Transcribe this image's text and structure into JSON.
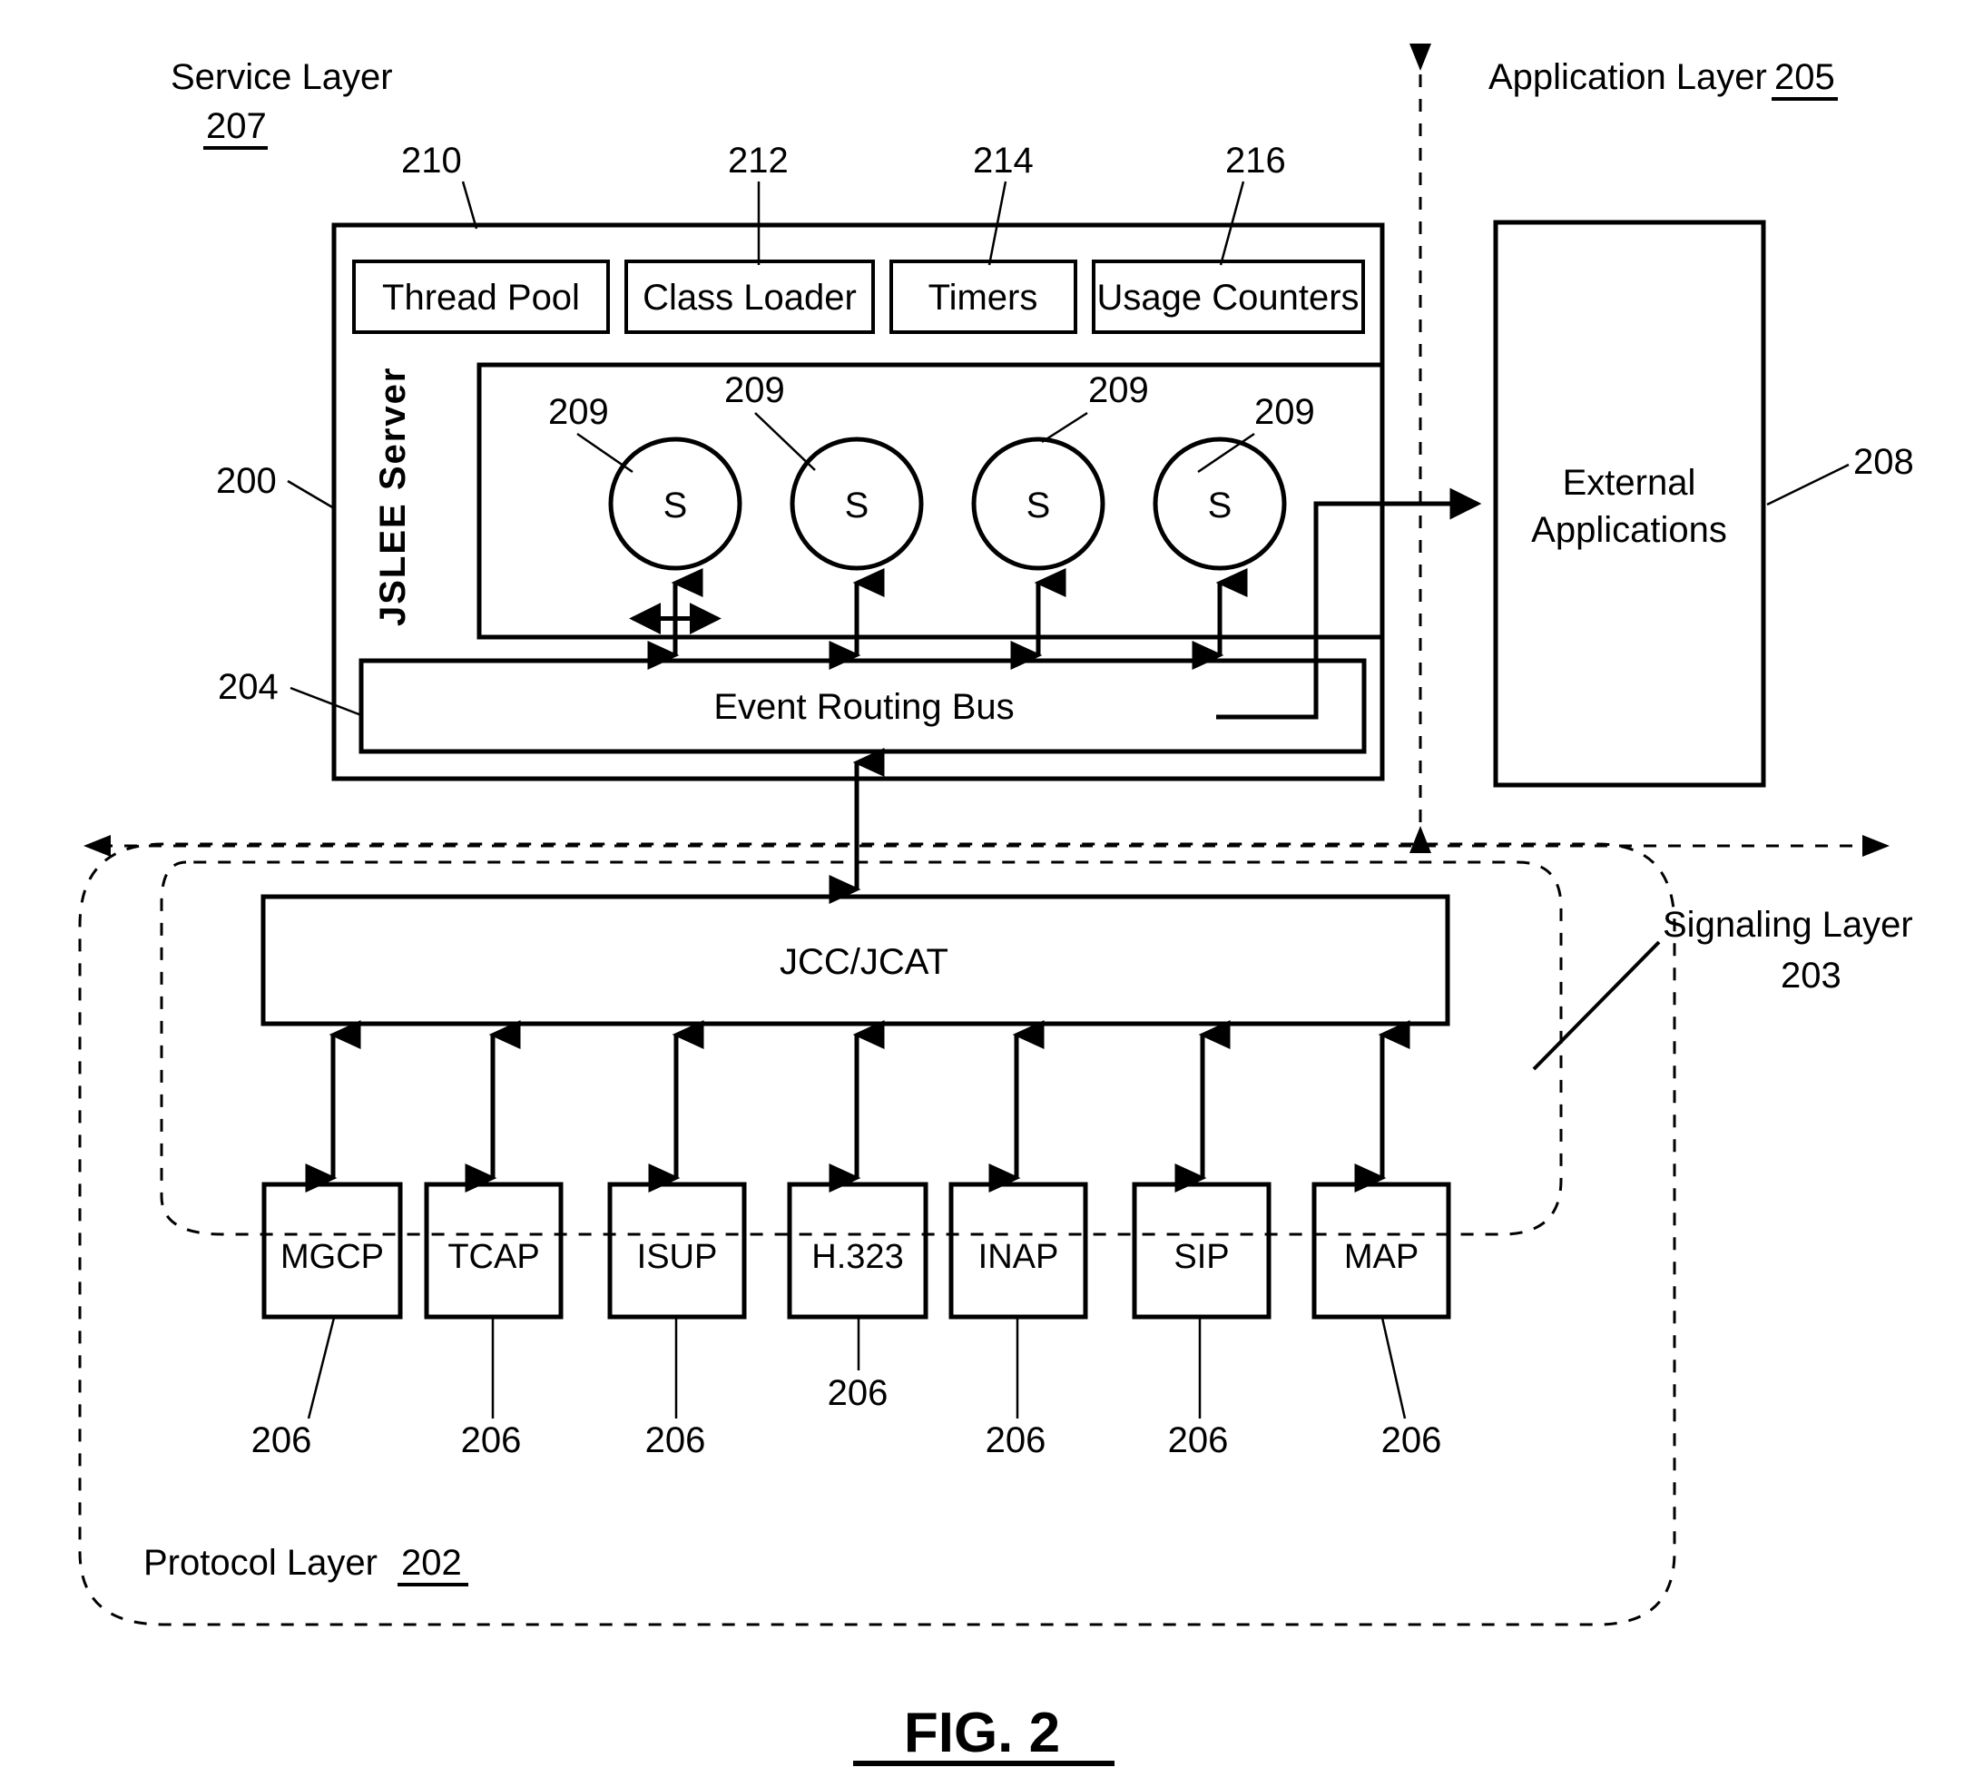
{
  "figure": {
    "caption": "FIG. 2"
  },
  "layers": {
    "service": {
      "name": "Service Layer",
      "ref": "207"
    },
    "application": {
      "name": "Application Layer",
      "ref": "205"
    },
    "signaling": {
      "name": "Signaling Layer",
      "ref": "203"
    },
    "protocol": {
      "name": "Protocol Layer",
      "ref": "202"
    }
  },
  "server": {
    "label": "JSLEE Server",
    "ref": "200",
    "components": [
      {
        "label": "Thread Pool",
        "ref": "210"
      },
      {
        "label": "Class Loader",
        "ref": "212"
      },
      {
        "label": "Timers",
        "ref": "214"
      },
      {
        "label": "Usage Counters",
        "ref": "216"
      }
    ],
    "services": [
      {
        "label": "S",
        "ref": "209"
      },
      {
        "label": "S",
        "ref": "209"
      },
      {
        "label": "S",
        "ref": "209"
      },
      {
        "label": "S",
        "ref": "209"
      }
    ],
    "event_bus": {
      "label": "Event Routing Bus",
      "ref": "204"
    }
  },
  "external_applications": {
    "label_line1": "External",
    "label_line2": "Applications",
    "ref": "208"
  },
  "api": {
    "label": "JCC/JCAT"
  },
  "protocols": [
    {
      "label": "MGCP",
      "ref": "206"
    },
    {
      "label": "TCAP",
      "ref": "206"
    },
    {
      "label": "ISUP",
      "ref": "206"
    },
    {
      "label": "H.323",
      "ref": "206"
    },
    {
      "label": "INAP",
      "ref": "206"
    },
    {
      "label": "SIP",
      "ref": "206"
    },
    {
      "label": "MAP",
      "ref": "206"
    }
  ],
  "colors": {
    "stroke": "#000000",
    "background": "#ffffff"
  }
}
